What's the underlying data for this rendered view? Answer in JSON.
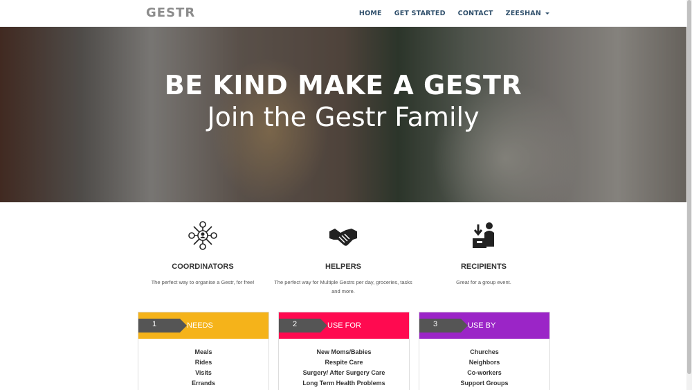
{
  "brand": "GESTR",
  "nav": {
    "home": "HOME",
    "get_started": "GET STARTED",
    "contact": "CONTACT",
    "user": "ZEESHAN"
  },
  "hero": {
    "title": "BE KIND MAKE A GESTR",
    "subtitle": "Join the Gestr Family"
  },
  "features": [
    {
      "icon": "network-people-icon",
      "title": "COORDINATORS",
      "desc": "The perfect way to organise a Gestr, for free!"
    },
    {
      "icon": "handshake-icon",
      "title": "HELPERS",
      "desc": "The perfect way for Multiple Gestrs per day, groceries, tasks and more."
    },
    {
      "icon": "recipient-box-icon",
      "title": "RECIPIENTS",
      "desc": "Great for a group event."
    }
  ],
  "cards": [
    {
      "num": "1",
      "label": "NEEDS",
      "color": "#f5b31a",
      "items": [
        "Meals",
        "Rides",
        "Visits",
        "Errands"
      ]
    },
    {
      "num": "2",
      "label": "USE FOR",
      "color": "#ff0a50",
      "items": [
        "New Moms/Babies",
        "Respite Care",
        "Surgery/ After Surgery Care",
        "Long Term Health Problems"
      ]
    },
    {
      "num": "3",
      "label": "USE BY",
      "color": "#9b25c7",
      "items": [
        "Churches",
        "Neighbors",
        "Co-workers",
        "Support Groups"
      ]
    }
  ]
}
